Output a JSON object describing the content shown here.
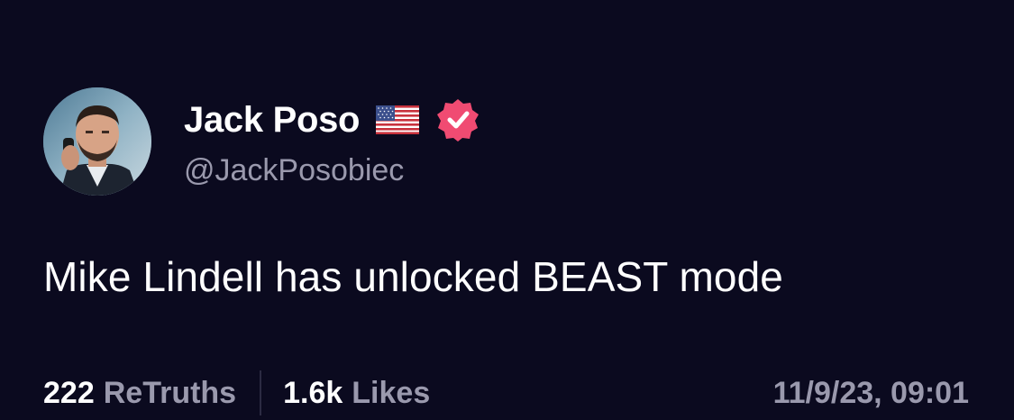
{
  "post": {
    "author": {
      "display_name": "Jack Poso",
      "flag_icon": "us-flag-icon",
      "verified_icon": "verified-badge-icon",
      "handle": "@JackPosobiec"
    },
    "text": "Mike Lindell has unlocked BEAST mode",
    "stats": {
      "retruths_count": "222",
      "retruths_label": "ReTruths",
      "likes_count": "1.6k",
      "likes_label": "Likes"
    },
    "timestamp": "11/9/23, 09:01"
  },
  "colors": {
    "background": "#0b0a1f",
    "primary_text": "#ffffff",
    "secondary_text": "#9a99ad",
    "verified_badge": "#f04b72",
    "divider": "#2c2b42"
  }
}
